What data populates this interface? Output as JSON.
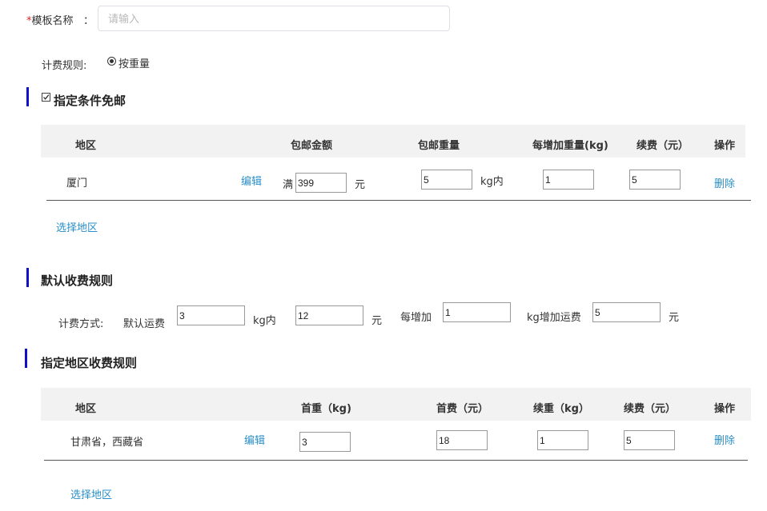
{
  "form": {
    "name_required_mark": "*",
    "name_label": "模板名称",
    "name_colon": "：",
    "name_placeholder": "请输入",
    "billing_label": "计费规则:",
    "billing_option": "按重量"
  },
  "free_shipping": {
    "title": "指定条件免邮",
    "checked": true,
    "columns": [
      "地区",
      "包邮金额",
      "包邮重量",
      "每增加重量(kg)",
      "续费（元）",
      "操作"
    ],
    "rows": [
      {
        "region": "厦门",
        "edit": "编辑",
        "amount_prefix": "满",
        "amount": "399",
        "amount_unit": "元",
        "weight": "5",
        "weight_unit": "kg内",
        "add_weight": "1",
        "renew_fee": "5",
        "delete": "删除"
      }
    ],
    "select_region": "选择地区"
  },
  "default_rule": {
    "title": "默认收费规则",
    "method_label": "计费方式:",
    "default_fee_label": "默认运费",
    "first_weight": "3",
    "first_weight_unit": "kg内",
    "first_fee": "12",
    "first_fee_unit": "元",
    "each_add_label": "每增加",
    "add_weight": "1",
    "add_fee_label": "kg增加运费",
    "add_fee": "5",
    "add_fee_unit": "元"
  },
  "region_rule": {
    "title": "指定地区收费规则",
    "columns": [
      "地区",
      "首重（kg)",
      "首费（元）",
      "续重（kg）",
      "续费（元）",
      "操作"
    ],
    "rows": [
      {
        "region": "甘肃省，西藏省",
        "edit": "编辑",
        "first_weight": "3",
        "first_fee": "18",
        "add_weight": "1",
        "add_fee": "5",
        "delete": "删除"
      }
    ],
    "select_region": "选择地区"
  },
  "colors": {
    "accent_bar": "#1010c8",
    "link": "#2a8fc8",
    "required": "#e02020",
    "table_header_bg": "#f2f2f2"
  }
}
